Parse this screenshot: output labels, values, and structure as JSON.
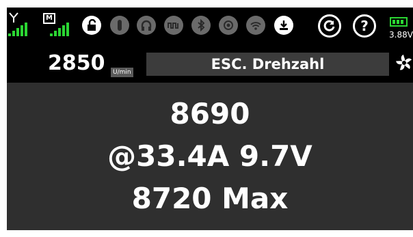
{
  "status": {
    "tx_icon": "antenna-icon",
    "rx_icon": "model-receiver-icon",
    "rx_label": "M",
    "icons": [
      {
        "name": "unlock-icon",
        "active": true
      },
      {
        "name": "stick-icon",
        "active": false
      },
      {
        "name": "headphones-icon",
        "active": false
      },
      {
        "name": "pulse-wave-icon",
        "active": false
      },
      {
        "name": "bluetooth-icon",
        "active": false
      },
      {
        "name": "target-icon",
        "active": false
      },
      {
        "name": "wifi-icon",
        "active": false
      },
      {
        "name": "download-icon",
        "active": true
      }
    ],
    "refresh_icon": "refresh-icon",
    "help_label": "?",
    "battery_voltage": "3.88V",
    "colors": {
      "signal": "#2bd633",
      "active_icon": "#ffffff",
      "inactive_icon": "#6a6a6a"
    }
  },
  "header": {
    "value": "2850",
    "unit": "U/min",
    "title": "ESC. Drehzahl",
    "fan_icon": "fan-icon"
  },
  "main": {
    "line1": "8690",
    "line2": "@33.4A 9.7V",
    "line3": "8720 Max"
  }
}
